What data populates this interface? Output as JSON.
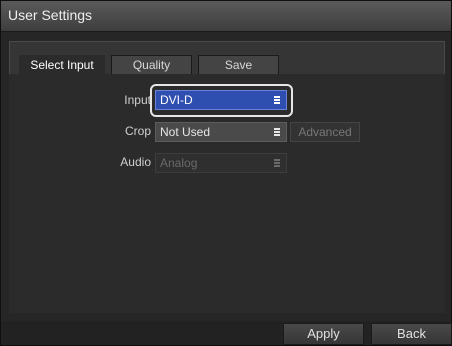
{
  "window": {
    "title": "User Settings"
  },
  "tabs": [
    {
      "label": "Select Input",
      "active": true
    },
    {
      "label": "Quality",
      "active": false
    },
    {
      "label": "Save",
      "active": false
    }
  ],
  "fields": {
    "input": {
      "label": "Input",
      "value": "DVI-D",
      "state": "focused"
    },
    "crop": {
      "label": "Crop",
      "value": "Not Used",
      "state": "normal"
    },
    "audio": {
      "label": "Audio",
      "value": "Analog",
      "state": "disabled"
    }
  },
  "advanced_button": {
    "label": "Advanced",
    "enabled": false
  },
  "footer": {
    "apply_label": "Apply",
    "back_label": "Back"
  },
  "colors": {
    "focus_fill": "#2f4fb0",
    "focus_ring": "#e6e6e6",
    "background": "#262626"
  },
  "icons": {
    "dropdown": "chevron-lines-icon"
  }
}
